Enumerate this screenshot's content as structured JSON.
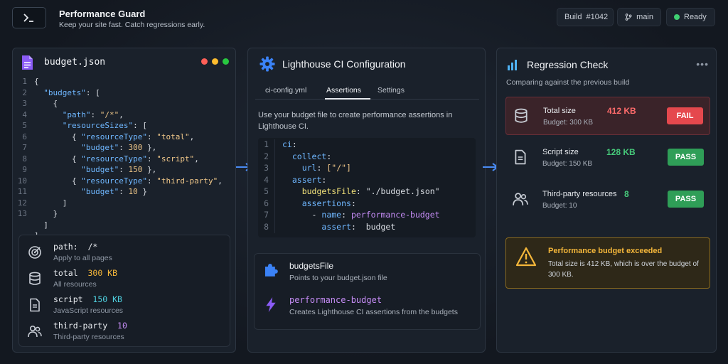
{
  "header": {
    "title": "Performance Guard",
    "subtitle": "Keep your site fast. Catch regressions early.",
    "build_label": "Build",
    "build_number": "#1042",
    "branch": "main",
    "status": "Ready",
    "status_color": "#3fcf72"
  },
  "budget_panel": {
    "filename": "budget.json",
    "window_dot_colors": [
      "#ff5f57",
      "#febc2e",
      "#28c840"
    ],
    "lines": [
      {
        "n": "1",
        "tokens": [
          {
            "t": "p",
            "v": "{"
          }
        ]
      },
      {
        "n": "2",
        "tokens": [
          {
            "t": "p",
            "v": "  "
          },
          {
            "t": "k",
            "v": "\"budgets\""
          },
          {
            "t": "p",
            "v": ": ["
          }
        ]
      },
      {
        "n": "3",
        "tokens": [
          {
            "t": "p",
            "v": "    {"
          }
        ]
      },
      {
        "n": "4",
        "tokens": [
          {
            "t": "p",
            "v": "      "
          },
          {
            "t": "k",
            "v": "\"path\""
          },
          {
            "t": "p",
            "v": ": "
          },
          {
            "t": "s",
            "v": "\"/*\""
          },
          {
            "t": "p",
            "v": ","
          }
        ]
      },
      {
        "n": "5",
        "tokens": [
          {
            "t": "p",
            "v": "      "
          },
          {
            "t": "k",
            "v": "\"resourceSizes\""
          },
          {
            "t": "p",
            "v": ": ["
          }
        ]
      },
      {
        "n": "6",
        "tokens": [
          {
            "t": "p",
            "v": "        { "
          },
          {
            "t": "k",
            "v": "\"resourceType\""
          },
          {
            "t": "p",
            "v": ": "
          },
          {
            "t": "s",
            "v": "\"total\""
          },
          {
            "t": "p",
            "v": ","
          }
        ]
      },
      {
        "n": "7",
        "tokens": [
          {
            "t": "p",
            "v": "          "
          },
          {
            "t": "k",
            "v": "\"budget\""
          },
          {
            "t": "p",
            "v": ": "
          },
          {
            "t": "n",
            "v": "300"
          },
          {
            "t": "p",
            "v": " },"
          }
        ]
      },
      {
        "n": "8",
        "tokens": [
          {
            "t": "p",
            "v": "        { "
          },
          {
            "t": "k",
            "v": "\"resourceType\""
          },
          {
            "t": "p",
            "v": ": "
          },
          {
            "t": "s",
            "v": "\"script\""
          },
          {
            "t": "p",
            "v": ","
          }
        ]
      },
      {
        "n": "9",
        "tokens": [
          {
            "t": "p",
            "v": "          "
          },
          {
            "t": "k",
            "v": "\"budget\""
          },
          {
            "t": "p",
            "v": ": "
          },
          {
            "t": "n",
            "v": "150"
          },
          {
            "t": "p",
            "v": " },"
          }
        ]
      },
      {
        "n": "10",
        "tokens": [
          {
            "t": "p",
            "v": "        { "
          },
          {
            "t": "k",
            "v": "\"resourceType\""
          },
          {
            "t": "p",
            "v": ": "
          },
          {
            "t": "s",
            "v": "\"third-party\""
          },
          {
            "t": "p",
            "v": ","
          }
        ]
      },
      {
        "n": "11",
        "tokens": [
          {
            "t": "p",
            "v": "          "
          },
          {
            "t": "k",
            "v": "\"budget\""
          },
          {
            "t": "p",
            "v": ": "
          },
          {
            "t": "n",
            "v": "10"
          },
          {
            "t": "p",
            "v": " }"
          }
        ]
      },
      {
        "n": "12",
        "tokens": [
          {
            "t": "p",
            "v": "      ]"
          }
        ]
      },
      {
        "n": "13",
        "tokens": [
          {
            "t": "p",
            "v": "    }"
          }
        ]
      },
      {
        "n": "",
        "tokens": [
          {
            "t": "p",
            "v": "  ]"
          }
        ]
      }
    ],
    "legend": [
      {
        "icon": "target-icon",
        "label": "path:",
        "value": "/*",
        "value_color": "#e9ecf0",
        "sub": "Apply to all pages"
      },
      {
        "icon": "database-icon",
        "label": "total",
        "value": "300 KB",
        "value_color": "#f5b73a",
        "sub": "All resources"
      },
      {
        "icon": "file-icon",
        "label": "script",
        "value": "150 KB",
        "value_color": "#4fd1e0",
        "sub": "JavaScript resources"
      },
      {
        "icon": "users-icon",
        "label": "third-party",
        "value": "10",
        "value_color": "#c58cf5",
        "sub": "Third-party resources"
      }
    ]
  },
  "config_panel": {
    "title": "Lighthouse CI Configuration",
    "tabs": [
      "ci-config.yml",
      "Assertions",
      "Settings"
    ],
    "description": "Use your budget file to create performance assertions in Lighthouse CI.",
    "lines": [
      {
        "n": "1",
        "tokens": [
          {
            "t": "k",
            "v": "ci"
          },
          {
            "t": "p",
            "v": ":"
          }
        ]
      },
      {
        "n": "2",
        "tokens": [
          {
            "t": "p",
            "v": "  "
          },
          {
            "t": "k",
            "v": "collect"
          },
          {
            "t": "p",
            "v": ":"
          }
        ]
      },
      {
        "n": "3",
        "tokens": [
          {
            "t": "p",
            "v": "    "
          },
          {
            "t": "k",
            "v": "url"
          },
          {
            "t": "p",
            "v": ": "
          },
          {
            "t": "s",
            "v": "[\"/\"]"
          }
        ]
      },
      {
        "n": "4",
        "tokens": [
          {
            "t": "p",
            "v": "  "
          },
          {
            "t": "k",
            "v": "assert"
          },
          {
            "t": "p",
            "v": ":"
          }
        ]
      },
      {
        "n": "5",
        "tokens": [
          {
            "t": "p",
            "v": "    "
          },
          {
            "t": "y",
            "v": "budgetsFile"
          },
          {
            "t": "p",
            "v": ": "
          },
          {
            "t": "p",
            "v": "\"./budget.json\""
          }
        ]
      },
      {
        "n": "6",
        "tokens": [
          {
            "t": "p",
            "v": "    "
          },
          {
            "t": "k",
            "v": "assertions"
          },
          {
            "t": "p",
            "v": ":"
          }
        ]
      },
      {
        "n": "7",
        "tokens": [
          {
            "t": "p",
            "v": "      - "
          },
          {
            "t": "k",
            "v": "name"
          },
          {
            "t": "p",
            "v": ": "
          },
          {
            "t": "pu",
            "v": "performance-budget"
          }
        ]
      },
      {
        "n": "8",
        "tokens": [
          {
            "t": "p",
            "v": "        "
          },
          {
            "t": "k",
            "v": "assert"
          },
          {
            "t": "p",
            "v": ":  budget"
          }
        ]
      }
    ],
    "definitions": [
      {
        "icon": "puzzle-icon",
        "name": "budgetsFile",
        "color": "#f2f4f7",
        "sub": "Points to your budget.json file"
      },
      {
        "icon": "bolt-icon",
        "name": "performance-budget",
        "color": "#c58cf5",
        "sub": "Creates Lighthouse CI assertions from the budgets"
      }
    ]
  },
  "regression_panel": {
    "title": "Regression Check",
    "subtitle": "Comparing against the previous build",
    "rows": [
      {
        "icon": "database-icon",
        "label": "Total size",
        "value": "412 KB",
        "value_color": "#ff6b6b",
        "budget": "Budget: 300 KB",
        "status": "FAIL",
        "status_color": "#e5484d"
      },
      {
        "icon": "file-icon",
        "label": "Script size",
        "value": "128 KB",
        "value_color": "#46c97a",
        "budget": "Budget: 150 KB",
        "status": "PASS",
        "status_color": "#2f9e57"
      },
      {
        "icon": "users-icon",
        "label": "Third-party resources",
        "value": "8",
        "value_color": "#46c97a",
        "budget": "Budget: 10",
        "status": "PASS",
        "status_color": "#2f9e57"
      }
    ],
    "alert": {
      "title": "Performance budget exceeded",
      "text": "Total size is 412 KB, which is over the budget of 300 KB."
    }
  }
}
